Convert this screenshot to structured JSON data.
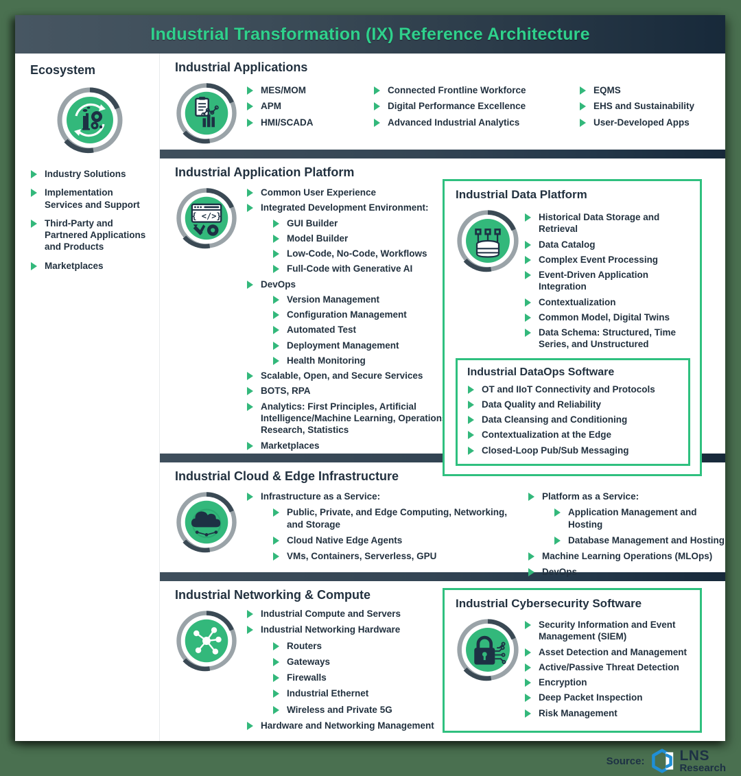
{
  "header": {
    "title": "Industrial Transformation (IX) Reference Architecture"
  },
  "colors": {
    "green": "#33b87b",
    "panel_border": "#2fc07f",
    "title_green": "#2fd18c",
    "dark_navy": "#17293a",
    "slate": "#3f4f5c",
    "page_bg": "#4a7050",
    "text": "#22313f"
  },
  "ecosystem": {
    "title": "Ecosystem",
    "icon": "factory-gears-cycle-icon",
    "items": [
      "Industry Solutions",
      "Implementation Services and Support",
      "Third-Party and Partnered Applications and Products",
      "Marketplaces"
    ]
  },
  "applications": {
    "title": "Industrial Applications",
    "icon": "clipboard-chart-icon",
    "col1": [
      "MES/MOM",
      "APM",
      "HMI/SCADA"
    ],
    "col2": [
      "Connected Frontline Workforce",
      "Digital Performance Excellence",
      "Advanced Industrial Analytics"
    ],
    "col3": [
      "EQMS",
      "EHS and Sustainability",
      "User-Developed Apps"
    ]
  },
  "platform": {
    "title": "Industrial Application Platform",
    "icon": "code-window-tools-icon",
    "items": [
      {
        "text": "Common User Experience",
        "level": 1
      },
      {
        "text": "Integrated Development Environment:",
        "level": 1
      },
      {
        "text": "GUI Builder",
        "level": 2
      },
      {
        "text": "Model Builder",
        "level": 2
      },
      {
        "text": "Low-Code, No-Code, Workflows",
        "level": 2
      },
      {
        "text": "Full-Code with Generative AI",
        "level": 2
      },
      {
        "text": "DevOps",
        "level": 1
      },
      {
        "text": "Version Management",
        "level": 2
      },
      {
        "text": "Configuration Management",
        "level": 2
      },
      {
        "text": "Automated Test",
        "level": 2
      },
      {
        "text": "Deployment Management",
        "level": 2
      },
      {
        "text": "Health Monitoring",
        "level": 2
      },
      {
        "text": "Scalable, Open, and Secure Services",
        "level": 1
      },
      {
        "text": "BOTS, RPA",
        "level": 1
      },
      {
        "text": "Analytics: First Principles, Artificial Intelligence/Machine Learning, Operations Research, Statistics",
        "level": 1
      },
      {
        "text": "Marketplaces",
        "level": 1
      }
    ]
  },
  "data_platform": {
    "title": "Industrial Data Platform",
    "icon": "database-nodes-icon",
    "items": [
      "Historical Data Storage and Retrieval",
      "Data Catalog",
      "Complex Event Processing",
      "Event-Driven Application Integration",
      "Contextualization",
      "Common Model, Digital Twins",
      "Data Schema: Structured, Time Series, and Unstructured"
    ],
    "dataops": {
      "title": "Industrial DataOps Software",
      "items": [
        "OT and IIoT Connectivity and Protocols",
        "Data Quality and Reliability",
        "Data Cleansing and Conditioning",
        "Contextualization at the Edge",
        "Closed-Loop Pub/Sub Messaging"
      ]
    }
  },
  "cloud": {
    "title": "Industrial Cloud & Edge Infrastructure",
    "icon": "cloud-edge-icon",
    "left": [
      {
        "text": "Infrastructure as a Service:",
        "level": 1
      },
      {
        "text": "Public, Private, and Edge Computing, Networking, and Storage",
        "level": 2
      },
      {
        "text": "Cloud Native Edge Agents",
        "level": 2
      },
      {
        "text": "VMs, Containers, Serverless, GPU",
        "level": 2
      }
    ],
    "right": [
      {
        "text": "Platform as a Service:",
        "level": 1
      },
      {
        "text": "Application Management and Hosting",
        "level": 2
      },
      {
        "text": "Database Management and Hosting",
        "level": 2
      },
      {
        "text": "Machine Learning Operations (MLOps)",
        "level": 1
      },
      {
        "text": "DevOps",
        "level": 1
      }
    ]
  },
  "networking": {
    "title": "Industrial Networking & Compute",
    "icon": "network-nodes-icon",
    "items": [
      {
        "text": "Industrial Compute and Servers",
        "level": 1
      },
      {
        "text": "Industrial Networking Hardware",
        "level": 1
      },
      {
        "text": "Routers",
        "level": 2
      },
      {
        "text": "Gateways",
        "level": 2
      },
      {
        "text": "Firewalls",
        "level": 2
      },
      {
        "text": "Industrial Ethernet",
        "level": 2
      },
      {
        "text": "Wireless and Private 5G",
        "level": 2
      },
      {
        "text": "Hardware and Networking Management",
        "level": 1
      }
    ]
  },
  "cybersecurity": {
    "title": "Industrial Cybersecurity Software",
    "icon": "padlock-circuit-icon",
    "items": [
      "Security Information and Event Management (SIEM)",
      "Asset Detection and Management",
      "Active/Passive Threat Detection",
      "Encryption",
      "Deep Packet Inspection",
      "Risk Management"
    ]
  },
  "footer": {
    "source_label": "Source:",
    "logo_icon": "lns-hexagon-icon",
    "brand_line1": "LNS",
    "brand_line2": "Research"
  }
}
